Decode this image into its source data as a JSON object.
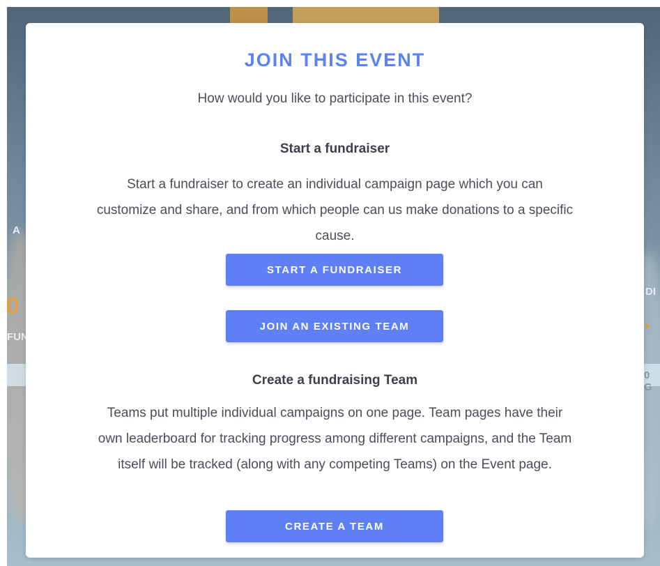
{
  "modal": {
    "title": "JOIN THIS EVENT",
    "subtitle": "How would you like to participate in this event?",
    "fundraiser_section": {
      "heading": "Start a fundraiser",
      "description": "Start a fundraiser to create an individual campaign page which you can customize and share, and from which people can us make donations to a specific cause.",
      "start_button": "START A FUNDRAISER",
      "join_team_button": "JOIN AN EXISTING TEAM"
    },
    "team_section": {
      "heading": "Create a fundraising Team",
      "description": "Teams put multiple individual campaigns on one page. Team pages have their own leaderboard for tracking progress among different campaigns, and the Team itself will be tracked (along with any competing Teams) on the Event page.",
      "create_team_button": "CREATE A TEAM"
    }
  },
  "colors": {
    "accent": "#5b82f0",
    "button": "#5f7ff5",
    "text": "#4b4e56"
  }
}
